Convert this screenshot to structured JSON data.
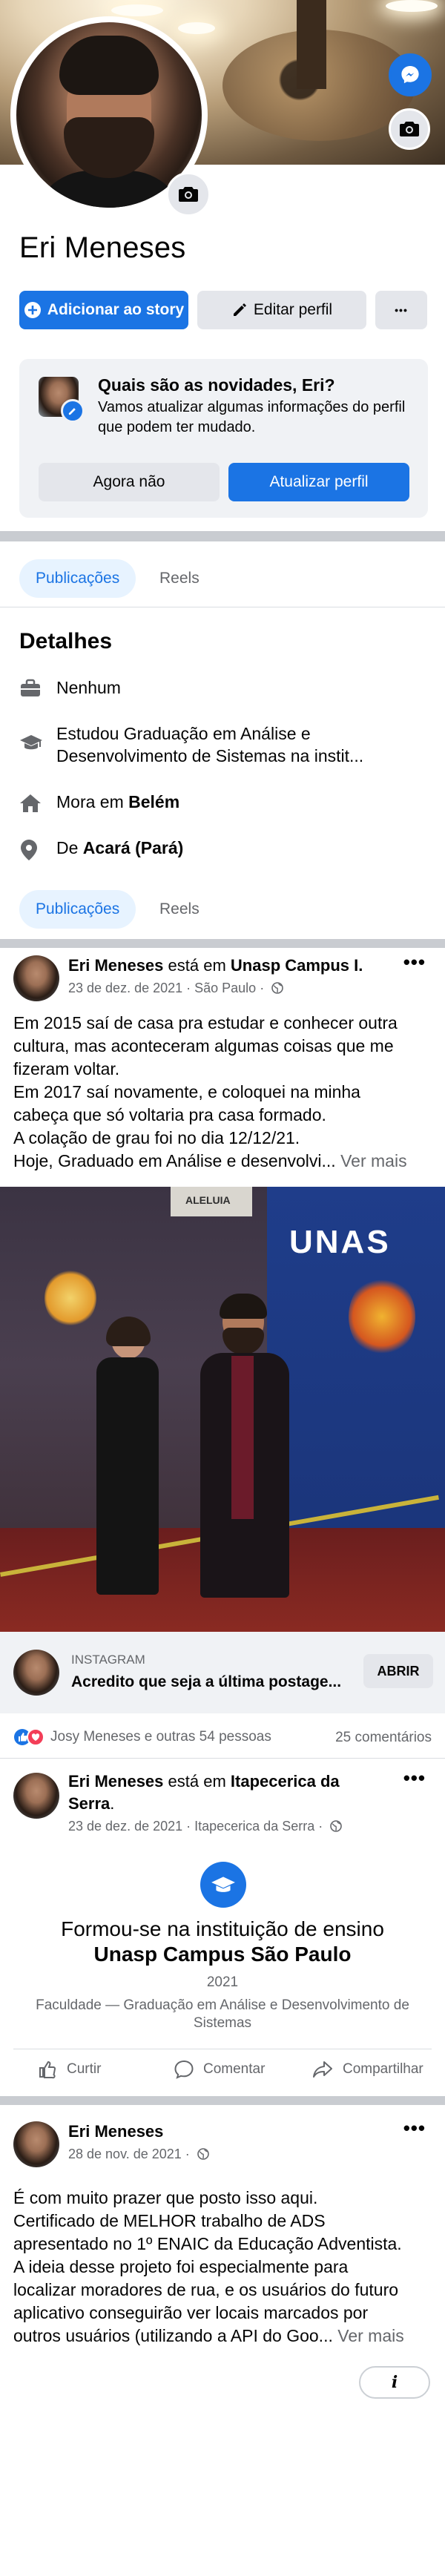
{
  "profile": {
    "name": "Eri Meneses",
    "add_story_label": "Adicionar ao story",
    "edit_profile_label": "Editar perfil",
    "more_label": "•••"
  },
  "prompt": {
    "title": "Quais são as novidades, Eri?",
    "body": "Vamos atualizar algumas informações do perfil que podem ter mudado.",
    "dismiss_label": "Agora não",
    "update_label": "Atualizar perfil"
  },
  "tabs_top": {
    "publicacoes": "Publicações",
    "reels": "Reels"
  },
  "details": {
    "title": "Detalhes",
    "work": "Nenhum",
    "education_1": "Estudou Graduação em Análise e",
    "education_2": "Desenvolvimento de Sistemas na instit...",
    "lives_prefix": "Mora em ",
    "lives_city": "Belém",
    "from_prefix": "De ",
    "from_city": "Acará (Pará)"
  },
  "tabs_bottom": {
    "publicacoes": "Publicações",
    "reels": "Reels"
  },
  "post1": {
    "author": "Eri Meneses",
    "at_text": " está em ",
    "place": "Unasp Campus I.",
    "date": "23 de dez. de 2021 · São Paulo · ",
    "lines": [
      "Em 2015 saí de casa pra estudar e conhecer outra",
      "cultura, mas aconteceram algumas coisas que me",
      "fizeram voltar.",
      "Em 2017 saí novamente, e coloquei na minha",
      "cabeça que só voltaria pra casa formado.",
      "A colação de grau foi no dia 12/12/21.",
      "Hoje, Graduado em Análise e desenvolvi..."
    ],
    "see_more": "Ver mais",
    "photo_sign": "UNAS",
    "photo_banner": "ALELUIA",
    "insta_source": "INSTAGRAM",
    "insta_caption": "Acredito que seja a última postage...",
    "insta_open": "ABRIR",
    "reactions_text": "Josy Meneses e outras 54 pessoas",
    "comments_text": "25 comentários"
  },
  "post2": {
    "author": "Eri Meneses",
    "at_text": " está em ",
    "place_1": "Itapecerica da",
    "place_2": "Serra",
    "place_dot": ".",
    "date": "23 de dez. de 2021 · Itapecerica da Serra · ",
    "event_line1": "Formou-se na instituição de ensino",
    "event_line2": "Unasp Campus São Paulo",
    "year": "2021",
    "course_1": "Faculdade — Graduação em Análise e Desenvolvimento de",
    "course_2": "Sistemas",
    "like": "Curtir",
    "comment": "Comentar",
    "share": "Compartilhar"
  },
  "post3": {
    "author": "Eri Meneses",
    "date": "28 de nov. de 2021 · ",
    "lines": [
      "É com muito prazer que posto isso aqui.",
      "Certificado de MELHOR trabalho de ADS",
      "apresentado no 1º ENAIC da Educação Adventista.",
      "A ideia desse projeto foi especialmente para",
      "localizar moradores de rua, e os usuários do futuro",
      "aplicativo conseguirão ver locais marcados por",
      "outros usuários (utilizando a API do Goo..."
    ],
    "see_more": "Ver mais",
    "info_label": "i"
  },
  "colors": {
    "accent": "#1b74e4",
    "secondary": "#e4e6eb",
    "muted": "#65676b"
  }
}
